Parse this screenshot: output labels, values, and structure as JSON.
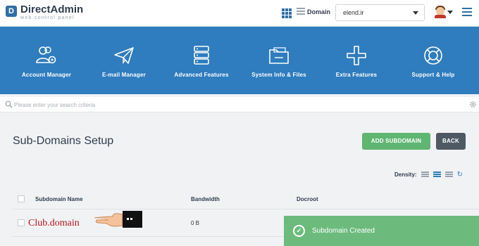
{
  "header": {
    "logo_badge": "D",
    "logo_title": "DirectAdmin",
    "logo_subtitle": "web control panel",
    "domain_label": "Domain",
    "domain_value": "elend.ir"
  },
  "nav": [
    {
      "label": "Account Manager",
      "icon": "users-gear-icon"
    },
    {
      "label": "E-mail Manager",
      "icon": "paper-plane-icon"
    },
    {
      "label": "Advanced Features",
      "icon": "server-icon"
    },
    {
      "label": "System Info & Files",
      "icon": "folder-icon"
    },
    {
      "label": "Extra Features",
      "icon": "plus-icon"
    },
    {
      "label": "Support & Help",
      "icon": "lifebuoy-icon"
    }
  ],
  "search": {
    "placeholder": "Please enter your search criteria"
  },
  "page": {
    "title": "Sub-Domains Setup",
    "add_button": "ADD SUBDOMAIN",
    "back_button": "BACK",
    "density_label": "Density:"
  },
  "table": {
    "columns": [
      "Subdomain Name",
      "Bandwidth",
      "Docroot"
    ],
    "rows": [
      {
        "name": "Club.domain",
        "bandwidth": "0 B",
        "docroot": ""
      }
    ]
  },
  "toast": {
    "message": "Subdomain Created"
  },
  "colors": {
    "accent": "#2f7cbe",
    "success": "#5fb572",
    "title": "#2f3d4e"
  }
}
